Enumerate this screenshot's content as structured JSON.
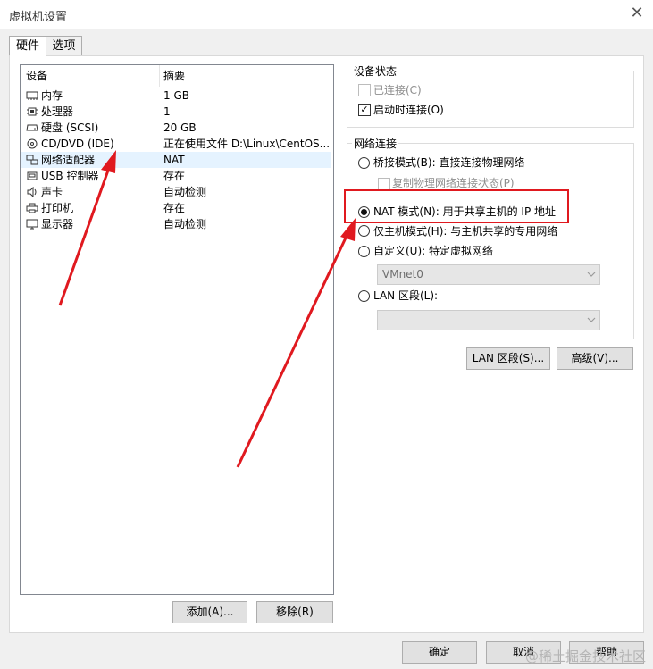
{
  "window": {
    "title": "虚拟机设置",
    "close_glyph": "✕"
  },
  "tabs": [
    {
      "label": "硬件"
    },
    {
      "label": "选项"
    }
  ],
  "device_list": {
    "col_device": "设备",
    "col_summary": "摘要",
    "rows": [
      {
        "icon": "memory-icon",
        "name": "内存",
        "summary": "1 GB"
      },
      {
        "icon": "cpu-icon",
        "name": "处理器",
        "summary": "1"
      },
      {
        "icon": "harddisk-icon",
        "name": "硬盘 (SCSI)",
        "summary": "20 GB"
      },
      {
        "icon": "cd-icon",
        "name": "CD/DVD (IDE)",
        "summary": "正在使用文件 D:\\Linux\\CentOS..."
      },
      {
        "icon": "network-icon",
        "name": "网络适配器",
        "summary": "NAT"
      },
      {
        "icon": "usb-icon",
        "name": "USB 控制器",
        "summary": "存在"
      },
      {
        "icon": "speaker-icon",
        "name": "声卡",
        "summary": "自动检测"
      },
      {
        "icon": "printer-icon",
        "name": "打印机",
        "summary": "存在"
      },
      {
        "icon": "monitor-icon",
        "name": "显示器",
        "summary": "自动检测"
      }
    ],
    "selected_index": 4,
    "add_button": "添加(A)...",
    "remove_button": "移除(R)"
  },
  "device_status": {
    "group_label": "设备状态",
    "connected": {
      "label": "已连接(C)",
      "checked": false,
      "disabled": true
    },
    "connect_at_power_on": {
      "label": "启动时连接(O)",
      "checked": true,
      "check_glyph": "✓"
    }
  },
  "network_connection": {
    "group_label": "网络连接",
    "bridged": {
      "label": "桥接模式(B): 直接连接物理网络",
      "selected": false
    },
    "replicate": {
      "label": "复制物理网络连接状态(P)",
      "checked": false,
      "disabled": true
    },
    "nat": {
      "label": "NAT 模式(N): 用于共享主机的 IP 地址",
      "selected": true
    },
    "host_only": {
      "label": "仅主机模式(H): 与主机共享的专用网络",
      "selected": false
    },
    "custom": {
      "label": "自定义(U): 特定虚拟网络",
      "selected": false,
      "value": "VMnet0"
    },
    "lan_segment": {
      "label": "LAN 区段(L):",
      "selected": false,
      "value": ""
    }
  },
  "buttons": {
    "lan_segments": "LAN 区段(S)...",
    "advanced": "高级(V)...",
    "ok": "确定",
    "cancel": "取消",
    "help": "帮助"
  },
  "watermark": "@稀土掘金技术社区",
  "colors": {
    "annotation_red": "#e0191f",
    "selection": "#e5f3ff"
  }
}
